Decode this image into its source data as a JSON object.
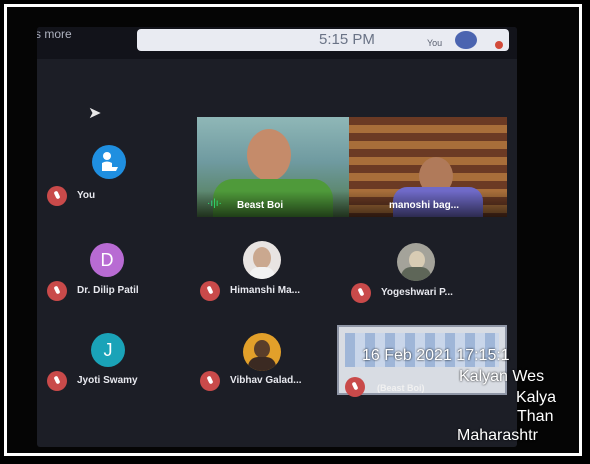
{
  "top": {
    "more_text": "s more",
    "time": "5:15 PM",
    "you": "You"
  },
  "participants": {
    "self": {
      "label": "You"
    },
    "dilip": {
      "initial": "D",
      "name": "Dr. Dilip Patil"
    },
    "himanshi": {
      "name": "Himanshi Ma..."
    },
    "yogeshwari": {
      "name": "Yogeshwari P..."
    },
    "jyoti": {
      "initial": "J",
      "name": "Jyoti Swamy"
    },
    "vibhav": {
      "name": "Vibhav Galad..."
    },
    "share": {
      "name": "(Beast Boi)"
    }
  },
  "video": {
    "left_name": "Beast Boi",
    "right_name": "manoshi bag..."
  },
  "overlay": {
    "line1": "16 Feb 2021 17:15:1",
    "line2": "Kalyan Wes",
    "line3": "Kalya",
    "line4": "Than",
    "line5": "Maharashtr"
  },
  "colors": {
    "dilip": "#b86bd3",
    "jyoti": "#1aa3b8",
    "self": "#1f8fe0"
  }
}
